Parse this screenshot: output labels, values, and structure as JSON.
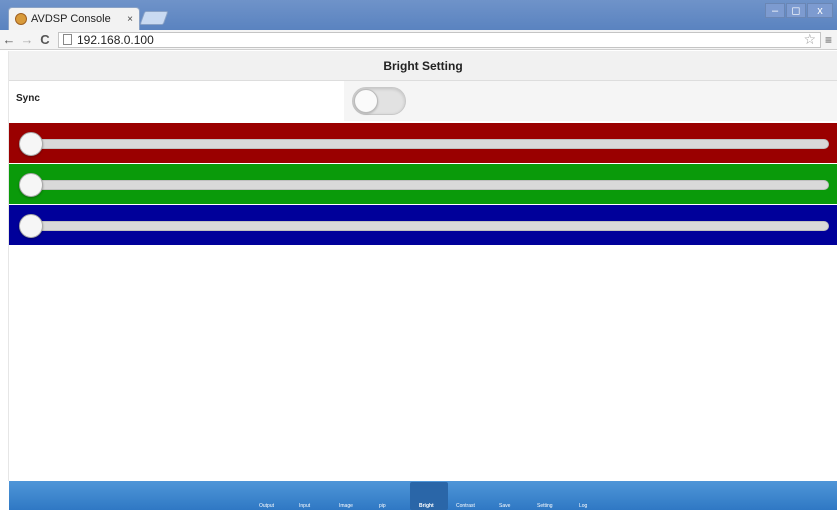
{
  "browser": {
    "tab_title": "AVDSP Console",
    "tab_close": "×",
    "url": "192.168.0.100",
    "window_controls": {
      "minimize": "–",
      "maximize": "◻",
      "close": "x"
    },
    "back_icon": "←",
    "forward_icon": "→",
    "reload_icon": "C",
    "star_icon": "☆",
    "menu_icon": "≡"
  },
  "page": {
    "title": "Bright Setting",
    "sync_label": "Sync",
    "sync_on": false
  },
  "sliders": [
    {
      "channel": "red",
      "color": "#9a0000",
      "value": 0
    },
    {
      "channel": "green",
      "color": "#0a9a0a",
      "value": 0
    },
    {
      "channel": "blue",
      "color": "#00009a",
      "value": 0
    }
  ],
  "footer_nav": {
    "accent": "#2f78c4",
    "items": [
      "Output",
      "Input",
      "Image",
      "pip",
      "Bright",
      "Contrast",
      "Save",
      "Setting",
      "Log"
    ],
    "active": "Bright"
  }
}
